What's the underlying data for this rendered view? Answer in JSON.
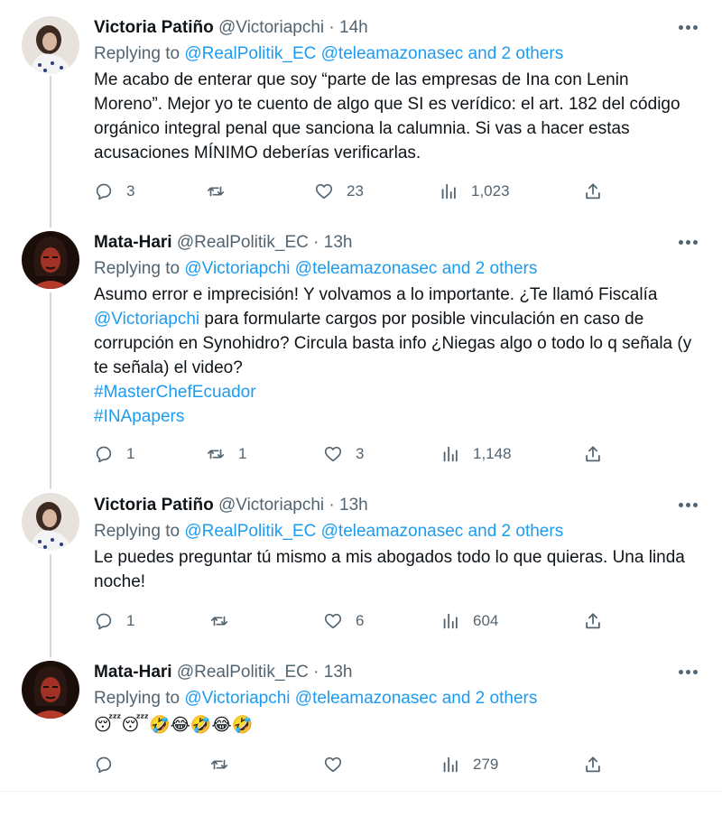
{
  "tweets": [
    {
      "name": "Victoria Patiño",
      "handle": "@Victoriapchi",
      "time": "14h",
      "replying_prefix": "Replying to",
      "replying_to": "@RealPolitik_EC @teleamazonasec and 2 others",
      "body": [
        "Me acabo de enterar que soy “parte de las empresas de Ina con Lenin Moreno”. Mejor yo te cuento de algo que SI es verídico: el art. 182 del código orgánico integral penal que sanciona la calumnia. Si vas a hacer estas acusaciones MÍNIMO deberías verificarlas."
      ],
      "replies": "3",
      "retweets": "",
      "likes": "23",
      "views": "1,023"
    },
    {
      "name": "Mata-Hari",
      "handle": "@RealPolitik_EC",
      "time": "13h",
      "replying_prefix": "Replying to",
      "replying_to": "@Victoriapchi @teleamazonasec and 2 others",
      "body_part1": "Asumo error e imprecisión! Y volvamos a lo importante. ¿Te llamó Fiscalía ",
      "body_mention": "@Victoriapchi",
      "body_part2": " para formularte cargos por posible vinculación en caso de corrupción en Synohidro? Circula basta info ¿Niegas algo o todo lo q señala (y te señala) el video?",
      "hashtag1": "#MasterChefEcuador",
      "hashtag2": "#INApapers",
      "replies": "1",
      "retweets": "1",
      "likes": "3",
      "views": "1,148"
    },
    {
      "name": "Victoria Patiño",
      "handle": "@Victoriapchi",
      "time": "13h",
      "replying_prefix": "Replying to",
      "replying_to": "@RealPolitik_EC @teleamazonasec and 2 others",
      "body": [
        "Le puedes preguntar tú mismo a mis abogados todo lo que quieras. Una linda noche!"
      ],
      "replies": "1",
      "retweets": "",
      "likes": "6",
      "views": "604"
    },
    {
      "name": "Mata-Hari",
      "handle": "@RealPolitik_EC",
      "time": "13h",
      "replying_prefix": "Replying to",
      "replying_to": "@Victoriapchi @teleamazonasec and 2 others",
      "body": [
        "😴😴🤣😂🤣😂🤣"
      ],
      "replies": "",
      "retweets": "",
      "likes": "",
      "views": "279"
    }
  ],
  "icons": {
    "reply": "reply-icon",
    "retweet": "retweet-icon",
    "like": "heart-icon",
    "views": "views-icon",
    "share": "share-icon",
    "more": "more-icon"
  },
  "colors": {
    "link": "#1d9bf0",
    "secondary_text": "#536471",
    "thread_line": "#cfd9de"
  }
}
